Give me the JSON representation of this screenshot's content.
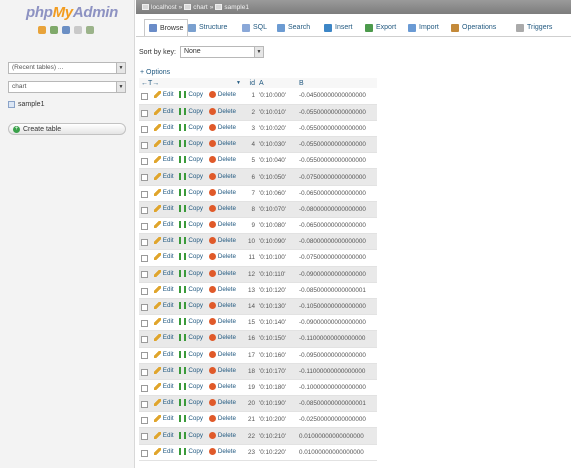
{
  "app": {
    "logo_php": "php",
    "logo_my": "My",
    "logo_admin": "Admin"
  },
  "left": {
    "recent": "(Recent tables) ...",
    "database": "chart",
    "table": "sample1",
    "create_table": "Create table",
    "icons": [
      "home-icon",
      "exit-icon",
      "query-icon",
      "docs-icon",
      "settings-icon"
    ]
  },
  "breadcrumb": {
    "server": "localhost",
    "database": "chart",
    "table": "sample1",
    "separator": "»"
  },
  "tabs": [
    {
      "label": "Browse",
      "icon": "browse-icon",
      "color": "#6a8cc8"
    },
    {
      "label": "Structure",
      "icon": "structure-icon",
      "color": "#7aa0cf"
    },
    {
      "label": "SQL",
      "icon": "sql-icon",
      "color": "#8aa8d8"
    },
    {
      "label": "Search",
      "icon": "search-icon",
      "color": "#6c9bd2"
    },
    {
      "label": "Insert",
      "icon": "insert-icon",
      "color": "#3d86c6"
    },
    {
      "label": "Export",
      "icon": "export-icon",
      "color": "#4c9a4c"
    },
    {
      "label": "Import",
      "icon": "import-icon",
      "color": "#6a9ad4"
    },
    {
      "label": "Operations",
      "icon": "operations-icon",
      "color": "#c48a3a"
    },
    {
      "label": "Triggers",
      "icon": "triggers-icon",
      "color": "#aaaaaa"
    }
  ],
  "sort": {
    "label": "Sort by key:",
    "value": "None"
  },
  "options_link": "+ Options",
  "table": {
    "nav_arrows": "←T→",
    "columns": [
      "id",
      "A",
      "B"
    ],
    "actions": {
      "edit": "Edit",
      "copy": "Copy",
      "delete": "Delete"
    },
    "rows": [
      {
        "id": "1",
        "a": "'0:10:000'",
        "b": "-0.04500000000000000"
      },
      {
        "id": "2",
        "a": "'0:10:010'",
        "b": "-0.05500000000000000"
      },
      {
        "id": "3",
        "a": "'0:10:020'",
        "b": "-0.05500000000000000"
      },
      {
        "id": "4",
        "a": "'0:10:030'",
        "b": "-0.05500000000000000"
      },
      {
        "id": "5",
        "a": "'0:10:040'",
        "b": "-0.05500000000000000"
      },
      {
        "id": "6",
        "a": "'0:10:050'",
        "b": "-0.07500000000000000"
      },
      {
        "id": "7",
        "a": "'0:10:060'",
        "b": "-0.06500000000000000"
      },
      {
        "id": "8",
        "a": "'0:10:070'",
        "b": "-0.08000000000000000"
      },
      {
        "id": "9",
        "a": "'0:10:080'",
        "b": "-0.06500000000000000"
      },
      {
        "id": "10",
        "a": "'0:10:090'",
        "b": "-0.08000000000000000"
      },
      {
        "id": "11",
        "a": "'0:10:100'",
        "b": "-0.07500000000000000"
      },
      {
        "id": "12",
        "a": "'0:10:110'",
        "b": "-0.09000000000000000"
      },
      {
        "id": "13",
        "a": "'0:10:120'",
        "b": "-0.08500000000000001"
      },
      {
        "id": "14",
        "a": "'0:10:130'",
        "b": "-0.10500000000000000"
      },
      {
        "id": "15",
        "a": "'0:10:140'",
        "b": "-0.09000000000000000"
      },
      {
        "id": "16",
        "a": "'0:10:150'",
        "b": "-0.11000000000000000"
      },
      {
        "id": "17",
        "a": "'0:10:160'",
        "b": "-0.09500000000000000"
      },
      {
        "id": "18",
        "a": "'0:10:170'",
        "b": "-0.11000000000000000"
      },
      {
        "id": "19",
        "a": "'0:10:180'",
        "b": "-0.10000000000000000"
      },
      {
        "id": "20",
        "a": "'0:10:190'",
        "b": "-0.08500000000000001"
      },
      {
        "id": "21",
        "a": "'0:10:200'",
        "b": "-0.02500000000000000"
      },
      {
        "id": "22",
        "a": "'0:10:210'",
        "b": "0.01000000000000000"
      },
      {
        "id": "23",
        "a": "'0:10:220'",
        "b": "0.01000000000000000"
      }
    ]
  }
}
